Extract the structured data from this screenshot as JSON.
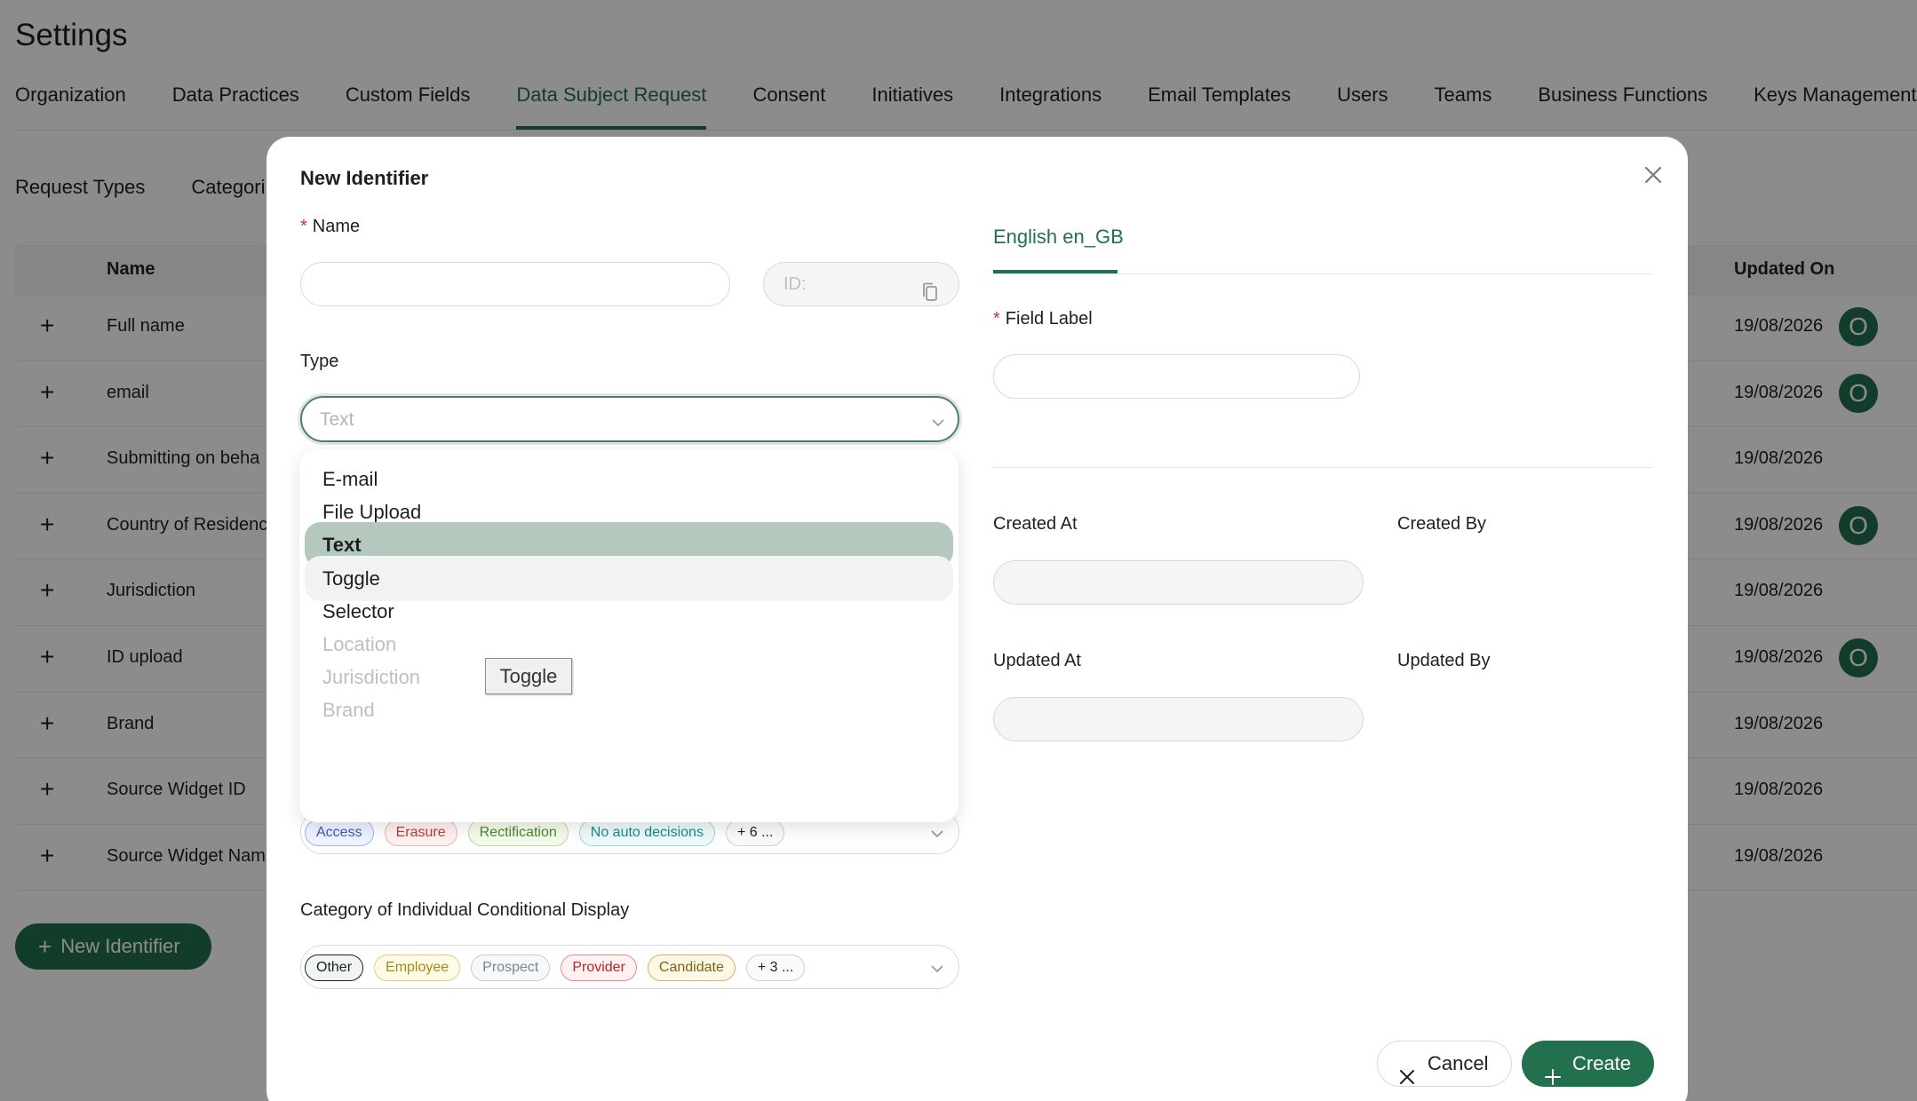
{
  "page": {
    "title": "Settings",
    "main_tabs": [
      "Organization",
      "Data Practices",
      "Custom Fields",
      "Data Subject Request",
      "Consent",
      "Initiatives",
      "Integrations",
      "Email Templates",
      "Users",
      "Teams",
      "Business Functions",
      "Keys Management"
    ],
    "active_main_tab": "Data Subject Request",
    "sub_tabs": [
      "Request Types",
      "Categori"
    ],
    "table": {
      "headers": {
        "name": "Name",
        "updated_on": "Updated On"
      },
      "rows": [
        {
          "name": "Full name",
          "updated": "19/08/2026",
          "avatar": "O"
        },
        {
          "name": "email",
          "updated": "19/08/2026",
          "avatar": "O"
        },
        {
          "name": "Submitting on beha",
          "updated": "19/08/2026",
          "avatar": ""
        },
        {
          "name": "Country of Residenc",
          "updated": "19/08/2026",
          "avatar": "O"
        },
        {
          "name": "Jurisdiction",
          "updated": "19/08/2026",
          "avatar": ""
        },
        {
          "name": "ID upload",
          "updated": "19/08/2026",
          "avatar": "O"
        },
        {
          "name": "Brand",
          "updated": "19/08/2026",
          "avatar": ""
        },
        {
          "name": "Source Widget ID",
          "updated": "19/08/2026",
          "avatar": ""
        },
        {
          "name": "Source Widget Nam",
          "updated": "19/08/2026",
          "avatar": ""
        }
      ],
      "plus_glyph": "+"
    },
    "new_identifier_button": "New Identifier"
  },
  "modal": {
    "title": "New Identifier",
    "required_mark": "*",
    "name_label": "Name",
    "name_value": "",
    "id_placeholder": "ID:",
    "type_label": "Type",
    "type_value": "Text",
    "type_options": [
      {
        "label": "E-mail",
        "state": "normal"
      },
      {
        "label": "File Upload",
        "state": "normal"
      },
      {
        "label": "Text",
        "state": "selected"
      },
      {
        "label": "Toggle",
        "state": "hover"
      },
      {
        "label": "Selector",
        "state": "normal"
      },
      {
        "label": "Location",
        "state": "disabled"
      },
      {
        "label": "Jurisdiction",
        "state": "disabled"
      },
      {
        "label": "Brand",
        "state": "disabled"
      }
    ],
    "tooltip": "Toggle",
    "request_type_tags": [
      {
        "label": "Access",
        "color": "#3b5bb5",
        "bg": "#eef3ff",
        "border": "#9fb4e6"
      },
      {
        "label": "Erasure",
        "color": "#b8403a",
        "bg": "#fff1f0",
        "border": "#f0b2ad"
      },
      {
        "label": "Rectification",
        "color": "#4a8a2a",
        "bg": "#f4fbec",
        "border": "#b8dca0"
      },
      {
        "label": "No auto decisions",
        "color": "#1e8a8a",
        "bg": "#edfafa",
        "border": "#9cd8d6"
      },
      {
        "label": "+ 6 ...",
        "color": "#1f1f1f",
        "bg": "#fafafa",
        "border": "#d0d0d0"
      }
    ],
    "category_label": "Category of Individual Conditional Display",
    "category_tags": [
      {
        "label": "Other",
        "color": "#1f1f1f",
        "bg": "#f0f5f2",
        "border": "#1f1f1f"
      },
      {
        "label": "Employee",
        "color": "#a08a1a",
        "bg": "#fffbe6",
        "border": "#e0cf7a"
      },
      {
        "label": "Prospect",
        "color": "#7a8596",
        "bg": "#f6f8fa",
        "border": "#c5ccd6"
      },
      {
        "label": "Provider",
        "color": "#b8242a",
        "bg": "#fff1f0",
        "border": "#e8888a"
      },
      {
        "label": "Candidate",
        "color": "#7a6414",
        "bg": "#fdf8e6",
        "border": "#c9b46a"
      },
      {
        "label": "+ 3 ...",
        "color": "#1f1f1f",
        "bg": "#fafafa",
        "border": "#d0d0d0"
      }
    ],
    "language_tab": "English en_GB",
    "field_label": "Field Label",
    "field_label_value": "",
    "created_at_label": "Created At",
    "created_by_label": "Created By",
    "updated_at_label": "Updated At",
    "updated_by_label": "Updated By",
    "cancel_button": "Cancel",
    "create_button": "Create",
    "accent": "#23704f"
  }
}
